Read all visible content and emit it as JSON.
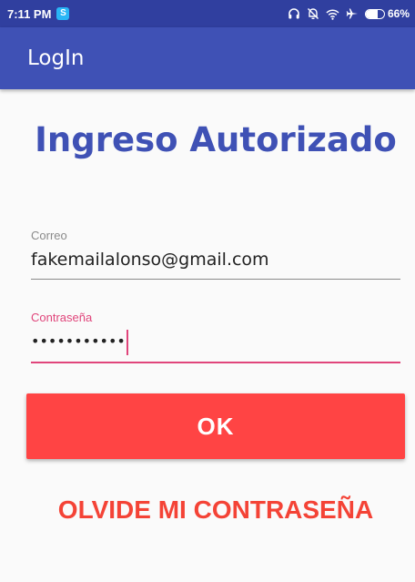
{
  "status_bar": {
    "time": "7:11 PM",
    "notification_icon": "s-app-icon",
    "icons": [
      "headphones-icon",
      "dnd-off-icon",
      "wifi-icon",
      "airplane-icon",
      "battery-icon"
    ],
    "battery_percent": "66%",
    "battery_level": 0.66
  },
  "app_bar": {
    "title": "LogIn"
  },
  "main": {
    "heading": "Ingreso Autorizado",
    "email": {
      "label": "Correo",
      "value": "fakemailalonso@gmail.com"
    },
    "password": {
      "label": "Contraseña",
      "value": "•••••••••••"
    },
    "ok_button": "OK",
    "forgot_link": "OLVIDE MI CONTRASEÑA"
  },
  "colors": {
    "status_bar": "#303f9f",
    "app_bar": "#3f51b5",
    "heading": "#3f51b5",
    "accent_pink": "#e0457b",
    "ok_button": "#ff4444",
    "forgot_link": "#f44336",
    "background": "#fafafa"
  }
}
